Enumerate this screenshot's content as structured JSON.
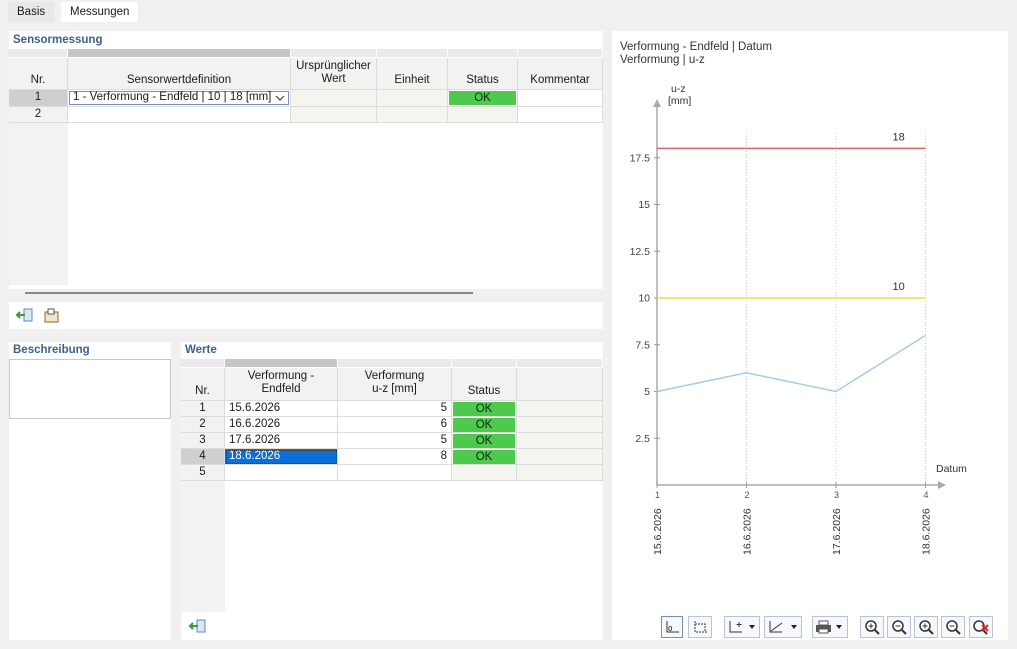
{
  "tabs": [
    {
      "label": "Basis"
    },
    {
      "label": "Messungen"
    }
  ],
  "sensor": {
    "title": "Sensormessung",
    "columns": {
      "nr": "Nr.",
      "definition": "Sensorwertdefinition",
      "original_line1": "Ursprünglicher",
      "original_line2": "Wert",
      "unit": "Einheit",
      "status": "Status",
      "comment": "Kommentar"
    },
    "rows": [
      {
        "nr": "1",
        "definition": "1 - Verformung - Endfeld | 10 | 18 [mm]",
        "status": "OK"
      },
      {
        "nr": "2"
      }
    ]
  },
  "description": {
    "title": "Beschreibung"
  },
  "values": {
    "title": "Werte",
    "columns": {
      "nr": "Nr.",
      "c1_line1": "Verformung -",
      "c1_line2": "Endfeld",
      "c2_line1": "Verformung",
      "c2_line2": "u-z [mm]",
      "status": "Status"
    },
    "rows": [
      {
        "nr": "1",
        "date": "15.6.2026",
        "value": "5",
        "status": "OK"
      },
      {
        "nr": "2",
        "date": "16.6.2026",
        "value": "6",
        "status": "OK"
      },
      {
        "nr": "3",
        "date": "17.6.2026",
        "value": "5",
        "status": "OK"
      },
      {
        "nr": "4",
        "date": "18.6.2026",
        "value": "8",
        "status": "OK"
      },
      {
        "nr": "5"
      }
    ]
  },
  "chart": {
    "title_line1": "Verformung - Endfeld | Datum",
    "title_line2": "Verformung | u-z"
  },
  "chart_data": {
    "type": "line",
    "ylabel_line1": "u-z",
    "ylabel_line2": "[mm]",
    "xlabel": "Datum",
    "x": [
      1,
      2,
      3,
      4
    ],
    "x_tick_labels": [
      "15.6.2026",
      "16.6.2026",
      "17.6.2026",
      "18.6.2026"
    ],
    "ylim": [
      0,
      20
    ],
    "y_ticks": [
      "2.5",
      "5",
      "7.5",
      "10",
      "12.5",
      "15",
      "17.5"
    ],
    "series": [
      {
        "values": [
          5,
          6,
          5,
          8
        ],
        "color": "#a7cbe8"
      }
    ],
    "limits": [
      {
        "value": 18,
        "label": "18",
        "color": "#e06666"
      },
      {
        "value": 10,
        "label": "10",
        "color": "#e8e040"
      }
    ],
    "grid": "vertical-dotted"
  },
  "colors": {
    "ok": "#4ec94e",
    "selection": "#0a6fd8",
    "title": "#3d5f8e"
  }
}
